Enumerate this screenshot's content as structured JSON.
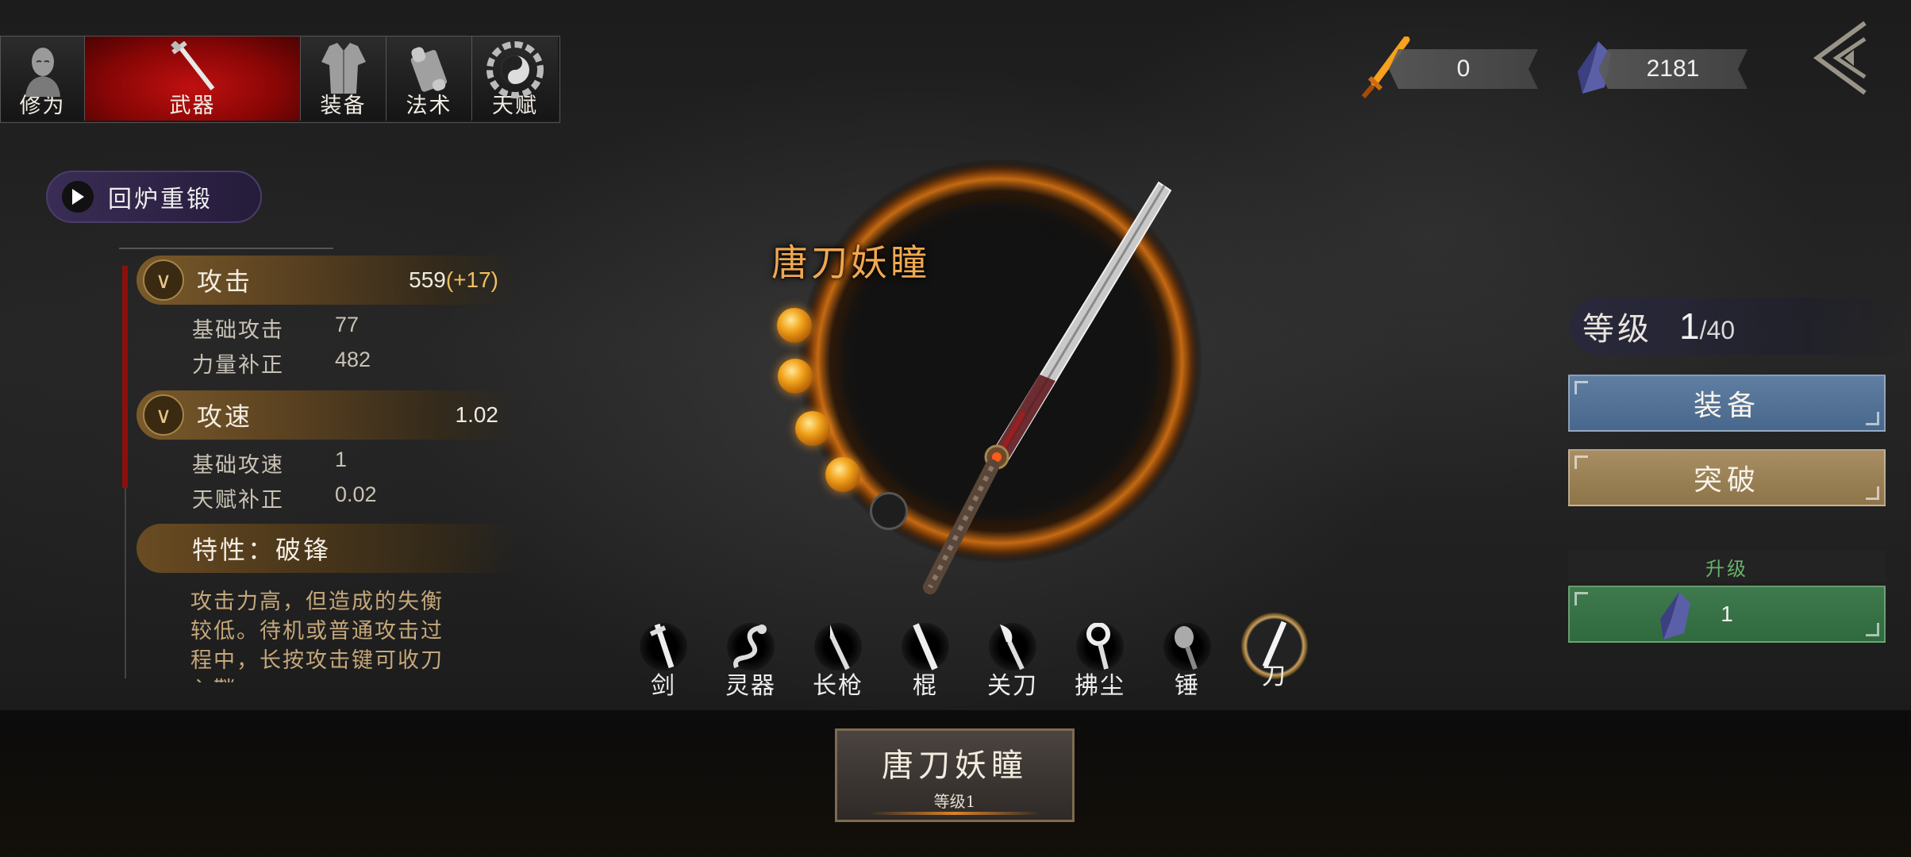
{
  "tabs": [
    {
      "label": "修为",
      "icon": "monk-head-icon"
    },
    {
      "label": "武器",
      "icon": "sword-icon"
    },
    {
      "label": "装备",
      "icon": "armor-icon"
    },
    {
      "label": "法术",
      "icon": "scroll-icon"
    },
    {
      "label": "天赋",
      "icon": "bagua-icon"
    }
  ],
  "currency": {
    "blade_shards": "0",
    "crystals": "2181"
  },
  "reforge_label": "回炉重锻",
  "stats": {
    "attack": {
      "name": "攻击",
      "value": "559",
      "bonus": "(+17)",
      "sub": [
        {
          "label": "基础攻击",
          "value": "77"
        },
        {
          "label": "力量补正",
          "value": "482"
        }
      ]
    },
    "speed": {
      "name": "攻速",
      "value": "1.02",
      "sub": [
        {
          "label": "基础攻速",
          "value": "1"
        },
        {
          "label": "天赋补正",
          "value": "0.02"
        }
      ]
    },
    "trait": {
      "name": "特性：破锋",
      "desc": "攻击力高，但造成的失衡较低。待机或普通攻击过程中，长按攻击键可收刀入鞘"
    }
  },
  "weapon": {
    "name": "唐刀妖瞳",
    "level_label": "等级1",
    "filled_slots": 4,
    "total_slots": 5
  },
  "level": {
    "label": "等级",
    "current": "1",
    "max": "/40"
  },
  "buttons": {
    "equip": "装备",
    "breakthrough": "突破",
    "upgrade_title": "升级",
    "upgrade_cost": "1"
  },
  "weapon_types": [
    {
      "label": "剑",
      "icon": "sword-type-icon"
    },
    {
      "label": "灵器",
      "icon": "dragon-icon"
    },
    {
      "label": "长枪",
      "icon": "spear-icon"
    },
    {
      "label": "棍",
      "icon": "staff-icon"
    },
    {
      "label": "关刀",
      "icon": "glaive-icon"
    },
    {
      "label": "拂尘",
      "icon": "whisk-icon"
    },
    {
      "label": "锤",
      "icon": "hammer-icon"
    },
    {
      "label": "刀",
      "icon": "blade-icon"
    }
  ],
  "selected_weapon_type": "刀"
}
